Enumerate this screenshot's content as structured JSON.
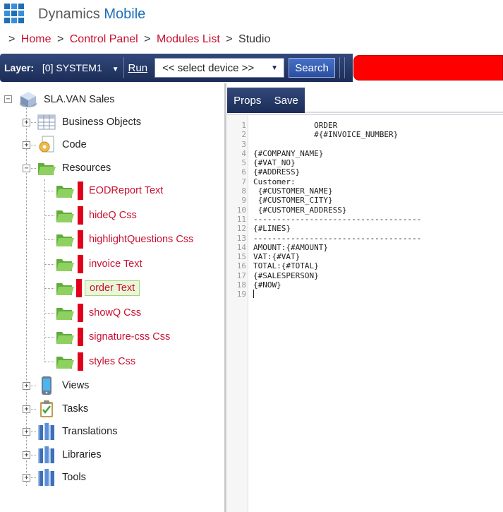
{
  "header": {
    "brand_part1": "Dynamics",
    "brand_part2": "Mobile"
  },
  "breadcrumb": {
    "items": [
      {
        "label": "Home",
        "link": true
      },
      {
        "label": "Control Panel",
        "link": true
      },
      {
        "label": "Modules List",
        "link": true
      },
      {
        "label": "Studio",
        "link": false
      }
    ],
    "separator": ">"
  },
  "toolbar": {
    "layer_label": "Layer:",
    "layer_value": "[0] SYSTEM1",
    "run_label": "Run",
    "device_select_value": "<< select device >>",
    "search_label": "Search",
    "alert_color": "#ff0000"
  },
  "tree": {
    "root": {
      "label": "SLA.VAN Sales",
      "icon": "database-cube-icon",
      "expanded": true
    },
    "nodes": [
      {
        "label": "Business Objects",
        "icon": "table-icon",
        "expanded": false
      },
      {
        "label": "Code",
        "icon": "code-gear-icon",
        "expanded": false
      },
      {
        "label": "Resources",
        "icon": "folder-open-icon",
        "expanded": true,
        "children": [
          {
            "label": "EODReport Text"
          },
          {
            "label": "hideQ Css"
          },
          {
            "label": "highlightQuestions Css"
          },
          {
            "label": "invoice Text"
          },
          {
            "label": "order Text",
            "selected": true
          },
          {
            "label": "showQ Css"
          },
          {
            "label": "signature-css Css"
          },
          {
            "label": "styles Css"
          }
        ]
      },
      {
        "label": "Views",
        "icon": "mobile-device-icon",
        "expanded": false
      },
      {
        "label": "Tasks",
        "icon": "clipboard-icon",
        "expanded": false
      },
      {
        "label": "Translations",
        "icon": "books-icon",
        "expanded": false
      },
      {
        "label": "Libraries",
        "icon": "books-icon",
        "expanded": false
      },
      {
        "label": "Tools",
        "icon": "books-icon",
        "expanded": false
      }
    ]
  },
  "editor": {
    "props_label": "Props",
    "save_label": "Save",
    "lines": [
      {
        "n": "1",
        "text": "             ORDER"
      },
      {
        "n": "2",
        "text": "             #{#INVOICE_NUMBER}"
      },
      {
        "n": "3",
        "text": ""
      },
      {
        "n": "4",
        "text": "{#COMPANY_NAME}"
      },
      {
        "n": "5",
        "text": "{#VAT_NO}"
      },
      {
        "n": "6",
        "text": "{#ADDRESS}"
      },
      {
        "n": "7",
        "text": "Customer:"
      },
      {
        "n": "8",
        "text": " {#CUSTOMER_NAME}"
      },
      {
        "n": "9",
        "text": " {#CUSTOMER_CITY}"
      },
      {
        "n": "10",
        "text": " {#CUSTOMER_ADDRESS}"
      },
      {
        "n": "11",
        "text": "------------------------------------"
      },
      {
        "n": "12",
        "text": "{#LINES}"
      },
      {
        "n": "13",
        "text": "------------------------------------"
      },
      {
        "n": "14",
        "text": "AMOUNT:{#AMOUNT}"
      },
      {
        "n": "15",
        "text": "VAT:{#VAT}"
      },
      {
        "n": "16",
        "text": "TOTAL:{#TOTAL}"
      },
      {
        "n": "17",
        "text": "{#SALESPERSON}"
      },
      {
        "n": "18",
        "text": "{#NOW}"
      },
      {
        "n": "19",
        "text": ""
      }
    ]
  }
}
